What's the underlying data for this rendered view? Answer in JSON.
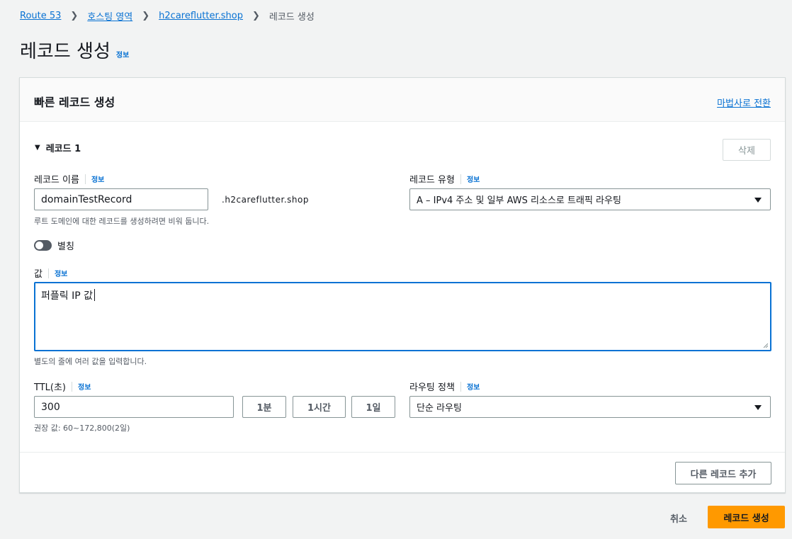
{
  "breadcrumb": {
    "items": [
      "Route 53",
      "호스팅 영역",
      "h2careflutter.shop"
    ],
    "current": "레코드 생성"
  },
  "page": {
    "title": "레코드 생성",
    "info": "정보"
  },
  "panel": {
    "title": "빠른 레코드 생성",
    "wizard_link": "마법사로 전환"
  },
  "record": {
    "header": "레코드 1",
    "delete_label": "삭제",
    "name": {
      "label": "레코드 이름",
      "info": "정보",
      "value": "domainTestRecord",
      "suffix": ".h2careflutter.shop",
      "hint": "루트 도메인에 대한 레코드를 생성하려면 비워 둡니다."
    },
    "type": {
      "label": "레코드 유형",
      "info": "정보",
      "selected": "A – IPv4 주소 및 일부 AWS 리소스로 트래픽 라우팅"
    },
    "alias": {
      "label": "별칭",
      "enabled": false
    },
    "value": {
      "label": "값",
      "info": "정보",
      "text": "퍼플릭 IP 값",
      "hint": "별도의 줄에 여러 값을 입력합니다."
    },
    "ttl": {
      "label": "TTL(초)",
      "info": "정보",
      "value": "300",
      "presets": [
        "1분",
        "1시간",
        "1일"
      ],
      "hint": "권장 값: 60~172,800(2일)"
    },
    "routing": {
      "label": "라우팅 정책",
      "info": "정보",
      "selected": "단순 라우팅"
    }
  },
  "add_record_label": "다른 레코드 추가",
  "cancel_label": "취소",
  "create_label": "레코드 생성",
  "colors": {
    "primary": "#ff9900",
    "link": "#0972d3",
    "focus": "#0972d3"
  }
}
